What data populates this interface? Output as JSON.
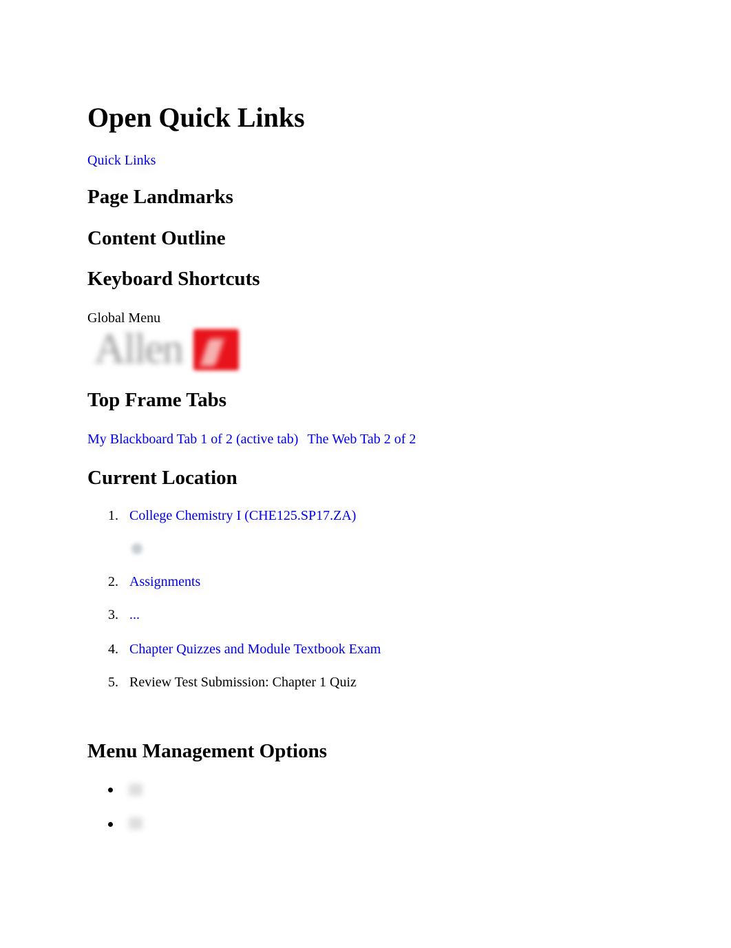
{
  "headings": {
    "open_quick_links": "Open Quick Links",
    "page_landmarks": "Page Landmarks",
    "content_outline": "Content Outline",
    "keyboard_shortcuts": "Keyboard Shortcuts",
    "top_frame_tabs": "Top Frame Tabs",
    "current_location": "Current Location",
    "menu_management_options": "Menu Management Options"
  },
  "quick_links": {
    "label": "Quick Links"
  },
  "global_menu": {
    "label": "Global Menu",
    "logo_icon": "institution-logo-icon"
  },
  "top_frame_tabs": {
    "tabs": [
      {
        "label": "My Blackboard Tab 1 of 2 (active tab)",
        "active": true
      },
      {
        "label": "The Web Tab 2 of 2",
        "active": false
      }
    ]
  },
  "breadcrumb": {
    "items": [
      {
        "number": "1.",
        "label": "College Chemistry I (CHE125.SP17.ZA)",
        "link": true
      },
      {
        "number": "2.",
        "label": "Assignments",
        "link": true
      },
      {
        "number": "3.",
        "label": "...",
        "link": true
      },
      {
        "number": "4.",
        "label": "Chapter Quizzes and Module Textbook Exam",
        "link": true
      },
      {
        "number": "5.",
        "label": "Review Test Submission: Chapter 1 Quiz",
        "link": false
      }
    ],
    "course_menu_icon": "course-menu-icon"
  },
  "menu_management": {
    "items": [
      {
        "icon": "menu-option-icon"
      },
      {
        "icon": "menu-option-icon"
      }
    ]
  },
  "colors": {
    "link": "#0000ee",
    "text": "#000000",
    "logo_red": "#e8131b"
  }
}
